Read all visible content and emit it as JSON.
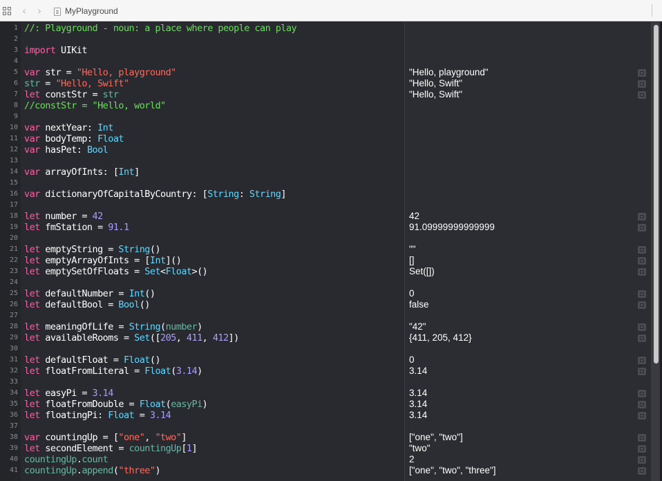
{
  "window": {
    "title": "MyPlayground"
  },
  "toolbar": {
    "back": "‹",
    "forward": "›"
  },
  "colors": {
    "background": "#292a30",
    "keyword": "#fc5fa3",
    "string": "#fc6a5d",
    "comment": "#6bdf5a",
    "type": "#5dd8ff",
    "number": "#a79dfc",
    "user_symbol": "#67b7a4"
  },
  "lines": [
    {
      "n": "1",
      "segs": [
        {
          "t": "//: Playground - noun: a place where people can play",
          "c": "c"
        }
      ]
    },
    {
      "n": "2",
      "segs": []
    },
    {
      "n": "3",
      "segs": [
        {
          "t": "import",
          "c": "k"
        },
        {
          "t": " UIKit",
          "c": "p"
        }
      ]
    },
    {
      "n": "4",
      "segs": []
    },
    {
      "n": "5",
      "segs": [
        {
          "t": "var",
          "c": "k"
        },
        {
          "t": " str = ",
          "c": "p"
        },
        {
          "t": "\"Hello, playground\"",
          "c": "s"
        }
      ],
      "result": "\"Hello, playground\"",
      "qv": true
    },
    {
      "n": "6",
      "segs": [
        {
          "t": "str",
          "c": "u"
        },
        {
          "t": " = ",
          "c": "p"
        },
        {
          "t": "\"Hello, Swift\"",
          "c": "s"
        }
      ],
      "result": "\"Hello, Swift\"",
      "qv": true
    },
    {
      "n": "7",
      "segs": [
        {
          "t": "let",
          "c": "k"
        },
        {
          "t": " constStr = ",
          "c": "p"
        },
        {
          "t": "str",
          "c": "u"
        }
      ],
      "result": "\"Hello, Swift\"",
      "qv": true
    },
    {
      "n": "8",
      "segs": [
        {
          "t": "//constStr = \"Hello, world\"",
          "c": "c"
        }
      ]
    },
    {
      "n": "9",
      "segs": []
    },
    {
      "n": "10",
      "segs": [
        {
          "t": "var",
          "c": "k"
        },
        {
          "t": " nextYear: ",
          "c": "p"
        },
        {
          "t": "Int",
          "c": "t"
        }
      ]
    },
    {
      "n": "11",
      "segs": [
        {
          "t": "var",
          "c": "k"
        },
        {
          "t": " bodyTemp: ",
          "c": "p"
        },
        {
          "t": "Float",
          "c": "t"
        }
      ]
    },
    {
      "n": "12",
      "segs": [
        {
          "t": "var",
          "c": "k"
        },
        {
          "t": " hasPet: ",
          "c": "p"
        },
        {
          "t": "Bool",
          "c": "t"
        }
      ]
    },
    {
      "n": "13",
      "segs": []
    },
    {
      "n": "14",
      "segs": [
        {
          "t": "var",
          "c": "k"
        },
        {
          "t": " arrayOfInts: [",
          "c": "p"
        },
        {
          "t": "Int",
          "c": "t"
        },
        {
          "t": "]",
          "c": "p"
        }
      ]
    },
    {
      "n": "15",
      "segs": []
    },
    {
      "n": "16",
      "segs": [
        {
          "t": "var",
          "c": "k"
        },
        {
          "t": " dictionaryOfCapitalByCountry: [",
          "c": "p"
        },
        {
          "t": "String",
          "c": "t"
        },
        {
          "t": ": ",
          "c": "p"
        },
        {
          "t": "String",
          "c": "t"
        },
        {
          "t": "]",
          "c": "p"
        }
      ]
    },
    {
      "n": "17",
      "segs": []
    },
    {
      "n": "18",
      "segs": [
        {
          "t": "let",
          "c": "k"
        },
        {
          "t": " number = ",
          "c": "p"
        },
        {
          "t": "42",
          "c": "n"
        }
      ],
      "result": "42",
      "qv": true
    },
    {
      "n": "19",
      "segs": [
        {
          "t": "let",
          "c": "k"
        },
        {
          "t": " fmStation = ",
          "c": "p"
        },
        {
          "t": "91.1",
          "c": "n"
        }
      ],
      "result": "91.09999999999999",
      "qv": true
    },
    {
      "n": "20",
      "segs": []
    },
    {
      "n": "21",
      "segs": [
        {
          "t": "let",
          "c": "k"
        },
        {
          "t": " emptyString = ",
          "c": "p"
        },
        {
          "t": "String",
          "c": "t"
        },
        {
          "t": "()",
          "c": "p"
        }
      ],
      "result": "\"\"",
      "qv": true
    },
    {
      "n": "22",
      "segs": [
        {
          "t": "let",
          "c": "k"
        },
        {
          "t": " emptyArrayOfInts = [",
          "c": "p"
        },
        {
          "t": "Int",
          "c": "t"
        },
        {
          "t": "]()",
          "c": "p"
        }
      ],
      "result": "[]",
      "qv": true
    },
    {
      "n": "23",
      "segs": [
        {
          "t": "let",
          "c": "k"
        },
        {
          "t": " emptySetOfFloats = ",
          "c": "p"
        },
        {
          "t": "Set",
          "c": "t"
        },
        {
          "t": "<",
          "c": "p"
        },
        {
          "t": "Float",
          "c": "t"
        },
        {
          "t": ">()",
          "c": "p"
        }
      ],
      "result": "Set([])",
      "qv": true
    },
    {
      "n": "24",
      "segs": []
    },
    {
      "n": "25",
      "segs": [
        {
          "t": "let",
          "c": "k"
        },
        {
          "t": " defaultNumber = ",
          "c": "p"
        },
        {
          "t": "Int",
          "c": "t"
        },
        {
          "t": "()",
          "c": "p"
        }
      ],
      "result": "0",
      "qv": true
    },
    {
      "n": "26",
      "segs": [
        {
          "t": "let",
          "c": "k"
        },
        {
          "t": " defaultBool = ",
          "c": "p"
        },
        {
          "t": "Bool",
          "c": "t"
        },
        {
          "t": "()",
          "c": "p"
        }
      ],
      "result": "false",
      "qv": true
    },
    {
      "n": "27",
      "segs": []
    },
    {
      "n": "28",
      "segs": [
        {
          "t": "let",
          "c": "k"
        },
        {
          "t": " meaningOfLife = ",
          "c": "p"
        },
        {
          "t": "String",
          "c": "t"
        },
        {
          "t": "(",
          "c": "p"
        },
        {
          "t": "number",
          "c": "u"
        },
        {
          "t": ")",
          "c": "p"
        }
      ],
      "result": "\"42\"",
      "qv": true
    },
    {
      "n": "29",
      "segs": [
        {
          "t": "let",
          "c": "k"
        },
        {
          "t": " availableRooms = ",
          "c": "p"
        },
        {
          "t": "Set",
          "c": "t"
        },
        {
          "t": "([",
          "c": "p"
        },
        {
          "t": "205",
          "c": "n"
        },
        {
          "t": ", ",
          "c": "p"
        },
        {
          "t": "411",
          "c": "n"
        },
        {
          "t": ", ",
          "c": "p"
        },
        {
          "t": "412",
          "c": "n"
        },
        {
          "t": "])",
          "c": "p"
        }
      ],
      "result": "{411, 205, 412}",
      "qv": true
    },
    {
      "n": "30",
      "segs": []
    },
    {
      "n": "31",
      "segs": [
        {
          "t": "let",
          "c": "k"
        },
        {
          "t": " defaultFloat = ",
          "c": "p"
        },
        {
          "t": "Float",
          "c": "t"
        },
        {
          "t": "()",
          "c": "p"
        }
      ],
      "result": "0",
      "qv": true
    },
    {
      "n": "32",
      "segs": [
        {
          "t": "let",
          "c": "k"
        },
        {
          "t": " floatFromLiteral = ",
          "c": "p"
        },
        {
          "t": "Float",
          "c": "t"
        },
        {
          "t": "(",
          "c": "p"
        },
        {
          "t": "3.14",
          "c": "n"
        },
        {
          "t": ")",
          "c": "p"
        }
      ],
      "result": "3.14",
      "qv": true
    },
    {
      "n": "33",
      "segs": []
    },
    {
      "n": "34",
      "segs": [
        {
          "t": "let",
          "c": "k"
        },
        {
          "t": " easyPi = ",
          "c": "p"
        },
        {
          "t": "3.14",
          "c": "n"
        }
      ],
      "result": "3.14",
      "qv": true
    },
    {
      "n": "35",
      "segs": [
        {
          "t": "let",
          "c": "k"
        },
        {
          "t": " floatFromDouble = ",
          "c": "p"
        },
        {
          "t": "Float",
          "c": "t"
        },
        {
          "t": "(",
          "c": "p"
        },
        {
          "t": "easyPi",
          "c": "u"
        },
        {
          "t": ")",
          "c": "p"
        }
      ],
      "result": "3.14",
      "qv": true
    },
    {
      "n": "36",
      "segs": [
        {
          "t": "let",
          "c": "k"
        },
        {
          "t": " floatingPi: ",
          "c": "p"
        },
        {
          "t": "Float",
          "c": "t"
        },
        {
          "t": " = ",
          "c": "p"
        },
        {
          "t": "3.14",
          "c": "n"
        }
      ],
      "result": "3.14",
      "qv": true
    },
    {
      "n": "37",
      "segs": []
    },
    {
      "n": "38",
      "segs": [
        {
          "t": "var",
          "c": "k"
        },
        {
          "t": " countingUp = [",
          "c": "p"
        },
        {
          "t": "\"one\"",
          "c": "s"
        },
        {
          "t": ", ",
          "c": "p"
        },
        {
          "t": "\"two\"",
          "c": "s"
        },
        {
          "t": "]",
          "c": "p"
        }
      ],
      "result": "[\"one\", \"two\"]",
      "qv": true
    },
    {
      "n": "39",
      "segs": [
        {
          "t": "let",
          "c": "k"
        },
        {
          "t": " secondElement = ",
          "c": "p"
        },
        {
          "t": "countingUp",
          "c": "u"
        },
        {
          "t": "[",
          "c": "p"
        },
        {
          "t": "1",
          "c": "n"
        },
        {
          "t": "]",
          "c": "p"
        }
      ],
      "result": "\"two\"",
      "qv": true
    },
    {
      "n": "40",
      "segs": [
        {
          "t": "countingUp",
          "c": "u"
        },
        {
          "t": ".",
          "c": "p"
        },
        {
          "t": "count",
          "c": "u"
        }
      ],
      "result": "2",
      "qv": true
    },
    {
      "n": "41",
      "segs": [
        {
          "t": "countingUp",
          "c": "u"
        },
        {
          "t": ".",
          "c": "p"
        },
        {
          "t": "append",
          "c": "u"
        },
        {
          "t": "(",
          "c": "p"
        },
        {
          "t": "\"three\"",
          "c": "s"
        },
        {
          "t": ")",
          "c": "p"
        }
      ],
      "result": "[\"one\", \"two\", \"three\"]",
      "qv": true
    }
  ]
}
